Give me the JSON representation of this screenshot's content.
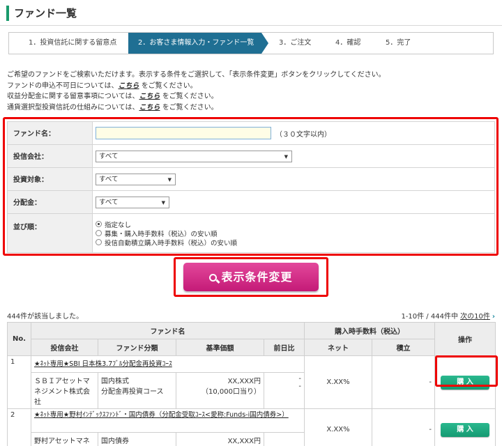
{
  "page": {
    "title": "ファンド一覧"
  },
  "steps": [
    {
      "label": "1．投資信託に関する留意点"
    },
    {
      "label": "2．お客さま情報入力・ファンド一覧"
    },
    {
      "label": "3．ご注文"
    },
    {
      "label": "4．確認"
    },
    {
      "label": "5．完了"
    }
  ],
  "intro": {
    "line1": "ご希望のファンドをご検索いただけます。表示する条件をご選択して、「表示条件変更」ボタンをクリックしてください。",
    "line2_pre": "ファンドの申込不可日については、",
    "line2_link": "こちら",
    "line2_post": "をご覧ください。",
    "line3_pre": "収益分配金に関する留意事項については、",
    "line3_link": "こちら",
    "line3_post": "をご覧ください。",
    "line4_pre": "通貨選択型投資信託の仕組みについては、",
    "line4_link": "こちら",
    "line4_post": "をご覧ください。"
  },
  "search": {
    "fund_name_label": "ファンド名：",
    "fund_name_value": "",
    "fund_name_hint": "（３０文字以内）",
    "company_label": "投信会社：",
    "company_value": "すべて",
    "target_label": "投資対象：",
    "target_value": "すべて",
    "dividend_label": "分配金：",
    "dividend_value": "すべて",
    "sort_label": "並び順：",
    "sort_options": [
      "指定なし",
      "募集・購入時手数料（税込）の安い順",
      "投信自動積立購入時手数料（税込）の安い順"
    ],
    "sort_selected": 0
  },
  "submit_label": "表示条件変更",
  "results": {
    "count_text": "444件が該当しました。",
    "range_text": "1-10件 / 444件中",
    "next_link": "次の10件",
    "headers": {
      "no": "No.",
      "fund_name": "ファンド名",
      "fee": "購入時手数料（税込）",
      "action": "操作",
      "company": "投信会社",
      "category": "ファンド分類",
      "price": "基準価額",
      "change": "前日比",
      "net": "ネット",
      "tsumitate": "積立"
    },
    "rows": [
      {
        "no": "1",
        "name": "★ﾈｯﾄ専用★SBI 日本株3.7ﾌﾞﾙ分配金再投資ｺｰｽ",
        "company": "ＳＢＩアセットマネジメント株式会社",
        "category1": "国内株式",
        "category2": "分配金再投資コース",
        "price": "XX,XXX円",
        "price_unit": "（10,000口当り）",
        "change1": "-",
        "change2": "-",
        "net": "X.XX%",
        "tsumitate": "-",
        "buy_label": "購 入"
      },
      {
        "no": "2",
        "name": "★ﾈｯﾄ専用★野村ｲﾝﾃﾞｯｸｽﾌｧﾝﾄﾞ・国内債券（分配金受取ｺｰｽ<愛称:Funds-i国内債券>）",
        "company": "野村アセットマネ",
        "category1": "国内債券",
        "category2": "",
        "price": "XX,XXX円",
        "price_unit": "",
        "change1": "",
        "change2": "",
        "net": "X.XX%",
        "tsumitate": "-",
        "buy_label": "購 入"
      }
    ]
  }
}
